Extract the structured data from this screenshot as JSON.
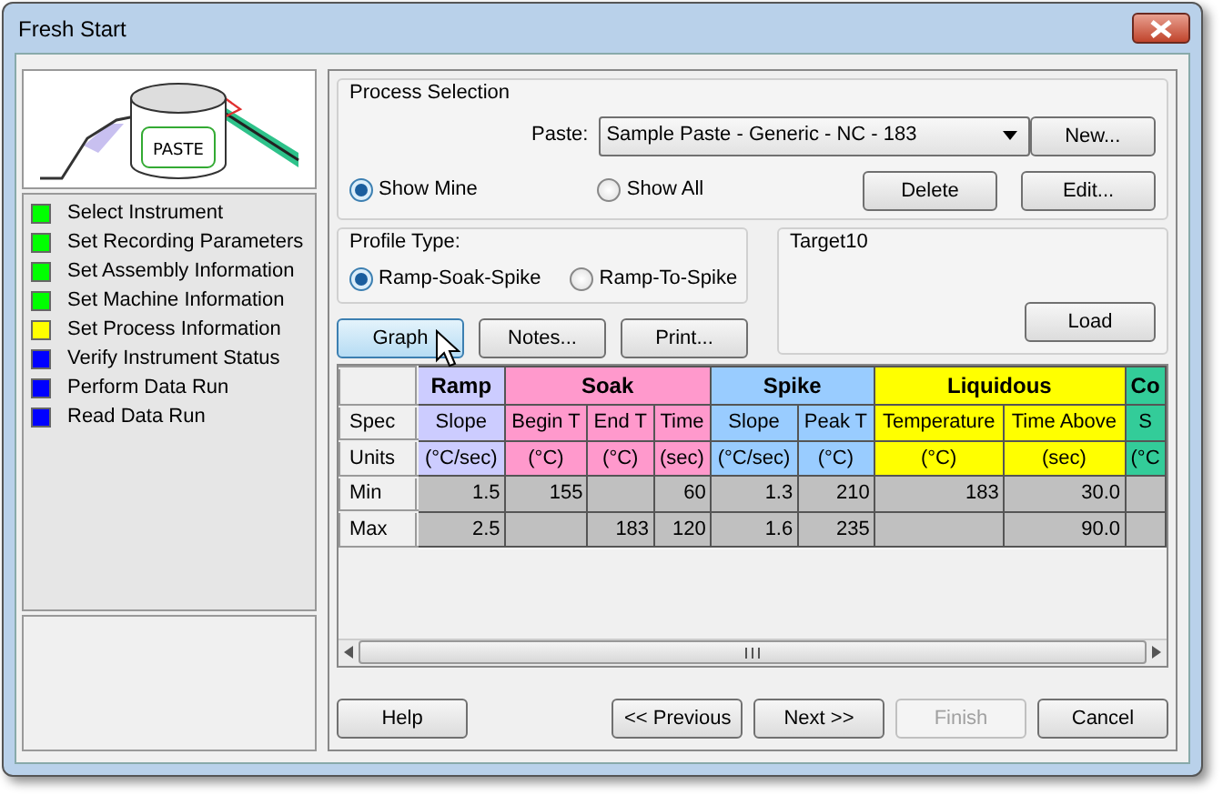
{
  "window": {
    "title": "Fresh Start"
  },
  "logo_label": "PASTE",
  "steps": [
    {
      "label": "Select Instrument",
      "color": "#00ff00"
    },
    {
      "label": "Set Recording Parameters",
      "color": "#00ff00"
    },
    {
      "label": "Set Assembly Information",
      "color": "#00ff00"
    },
    {
      "label": "Set Machine Information",
      "color": "#00ff00"
    },
    {
      "label": "Set Process Information",
      "color": "#ffff00"
    },
    {
      "label": "Verify Instrument Status",
      "color": "#0000ff"
    },
    {
      "label": "Perform Data Run",
      "color": "#0000ff"
    },
    {
      "label": "Read Data Run",
      "color": "#0000ff"
    }
  ],
  "process_selection": {
    "title": "Process Selection",
    "paste_label": "Paste:",
    "paste_value": "Sample Paste - Generic - NC - 183",
    "filters": [
      {
        "label": "Show Mine",
        "selected": true
      },
      {
        "label": "Show All",
        "selected": false
      }
    ],
    "buttons": {
      "new": "New...",
      "delete": "Delete",
      "edit": "Edit..."
    }
  },
  "profile_type": {
    "title": "Profile Type:",
    "options": [
      {
        "label": "Ramp-Soak-Spike",
        "selected": true
      },
      {
        "label": "Ramp-To-Spike",
        "selected": false
      }
    ]
  },
  "target": {
    "title": "Target10",
    "load": "Load"
  },
  "action_buttons": [
    {
      "label": "Graph",
      "highlighted": true
    },
    {
      "label": "Notes...",
      "highlighted": false
    },
    {
      "label": "Print...",
      "highlighted": false
    }
  ],
  "table": {
    "row_headers": [
      "Spec",
      "Units"
    ],
    "groups": [
      {
        "label": "Ramp",
        "color": "#ccccff",
        "columns": [
          {
            "spec": "Slope",
            "units": "(°C/sec)"
          }
        ]
      },
      {
        "label": "Soak",
        "color": "#ff99cc",
        "columns": [
          {
            "spec": "Begin T",
            "units": "(°C)"
          },
          {
            "spec": "End T",
            "units": "(°C)"
          },
          {
            "spec": "Time",
            "units": "(sec)"
          }
        ]
      },
      {
        "label": "Spike",
        "color": "#99ccff",
        "columns": [
          {
            "spec": "Slope",
            "units": "(°C/sec)"
          },
          {
            "spec": "Peak T",
            "units": "(°C)"
          }
        ]
      },
      {
        "label": "Liquidous",
        "color": "#ffff00",
        "columns": [
          {
            "spec": "Temperature",
            "units": "(°C)"
          },
          {
            "spec": "Time Above",
            "units": "(sec)"
          }
        ]
      },
      {
        "label": "Co",
        "color": "#33cc99",
        "columns": [
          {
            "spec": "S",
            "units": "(°C"
          }
        ]
      }
    ],
    "rows": [
      {
        "label": "Min",
        "cells": [
          "1.5",
          "155",
          null,
          "60",
          "1.3",
          "210",
          "183",
          "30.0",
          null
        ]
      },
      {
        "label": "Max",
        "cells": [
          "2.5",
          null,
          "183",
          "120",
          "1.6",
          "235",
          null,
          "90.0",
          null
        ]
      }
    ]
  },
  "footer_buttons": [
    {
      "label": "Help",
      "disabled": false
    },
    {
      "label": "<< Previous",
      "disabled": false
    },
    {
      "label": "Next >>",
      "disabled": false
    },
    {
      "label": "Finish",
      "disabled": true
    },
    {
      "label": "Cancel",
      "disabled": false
    }
  ]
}
